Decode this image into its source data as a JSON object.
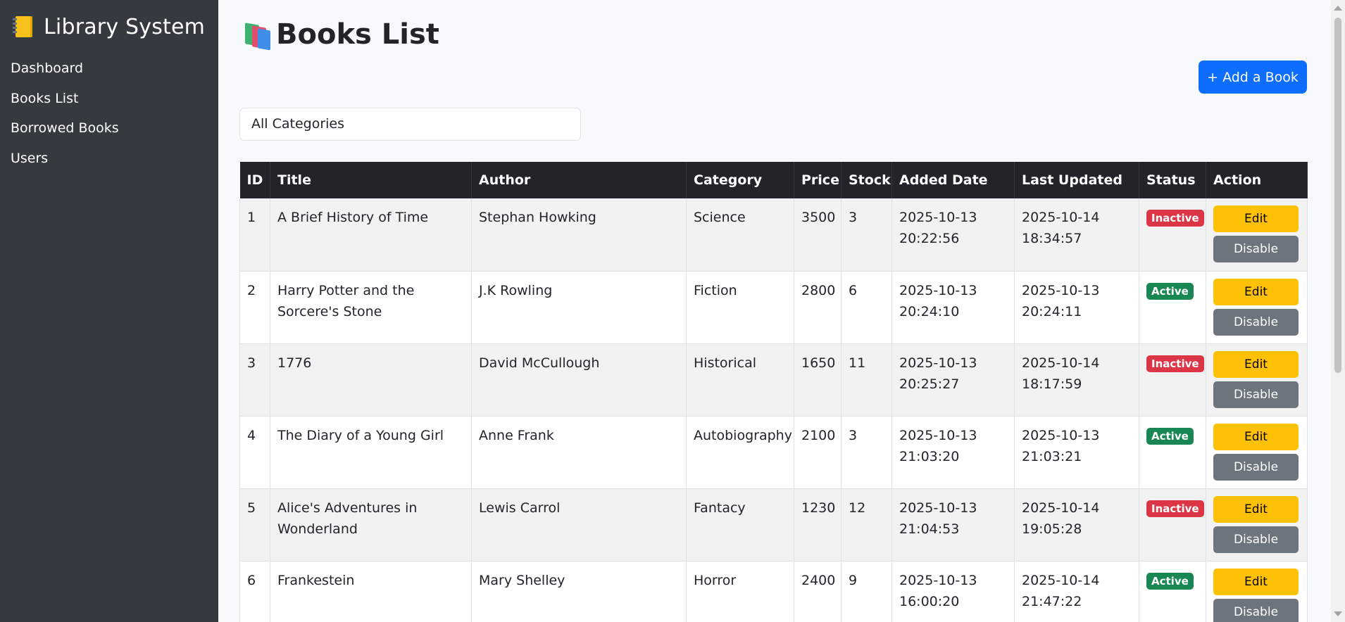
{
  "sidebar": {
    "brand": "Library System",
    "brand_icon": "notebook-icon",
    "items": [
      {
        "label": "Dashboard"
      },
      {
        "label": "Books List"
      },
      {
        "label": "Borrowed Books"
      },
      {
        "label": "Users"
      }
    ]
  },
  "main": {
    "title": "Books List",
    "title_icon": "books-icon",
    "add_button": "+ Add a Book",
    "category_filter": {
      "selected": "All Categories"
    }
  },
  "table": {
    "headers": [
      "ID",
      "Title",
      "Author",
      "Category",
      "Price",
      "Stock",
      "Added Date",
      "Last Updated",
      "Status",
      "Action"
    ],
    "rows": [
      {
        "id": "1",
        "title": "A Brief History of Time",
        "author": "Stephan Howking",
        "category": "Science",
        "price": "3500",
        "stock": "3",
        "added": "2025-10-13 20:22:56",
        "updated": "2025-10-14 18:34:57",
        "status": "Inactive",
        "edit": "Edit",
        "disable": "Disable"
      },
      {
        "id": "2",
        "title": "Harry Potter and the Sorcere's Stone",
        "author": "J.K Rowling",
        "category": "Fiction",
        "price": "2800",
        "stock": "6",
        "added": "2025-10-13 20:24:10",
        "updated": "2025-10-13 20:24:11",
        "status": "Active",
        "edit": "Edit",
        "disable": "Disable"
      },
      {
        "id": "3",
        "title": "1776",
        "author": "David McCullough",
        "category": "Historical",
        "price": "1650",
        "stock": "11",
        "added": "2025-10-13 20:25:27",
        "updated": "2025-10-14 18:17:59",
        "status": "Inactive",
        "edit": "Edit",
        "disable": "Disable"
      },
      {
        "id": "4",
        "title": "The Diary of a Young Girl",
        "author": "Anne Frank",
        "category": "Autobiography",
        "price": "2100",
        "stock": "3",
        "added": "2025-10-13 21:03:20",
        "updated": "2025-10-13 21:03:21",
        "status": "Active",
        "edit": "Edit",
        "disable": "Disable"
      },
      {
        "id": "5",
        "title": "Alice's Adventures in Wonderland",
        "author": "Lewis Carrol",
        "category": "Fantacy",
        "price": "1230",
        "stock": "12",
        "added": "2025-10-13 21:04:53",
        "updated": "2025-10-14 19:05:28",
        "status": "Inactive",
        "edit": "Edit",
        "disable": "Disable"
      },
      {
        "id": "6",
        "title": "Frankestein",
        "author": "Mary Shelley",
        "category": "Horror",
        "price": "2400",
        "stock": "9",
        "added": "2025-10-13 16:00:20",
        "updated": "2025-10-14 21:47:22",
        "status": "Active",
        "edit": "Edit",
        "disable": "Disable"
      }
    ]
  },
  "colors": {
    "sidebar_bg": "#343a40",
    "primary": "#0d6efd",
    "active": "#198754",
    "inactive": "#dc3545",
    "edit": "#ffc107",
    "disable": "#6c757d"
  }
}
